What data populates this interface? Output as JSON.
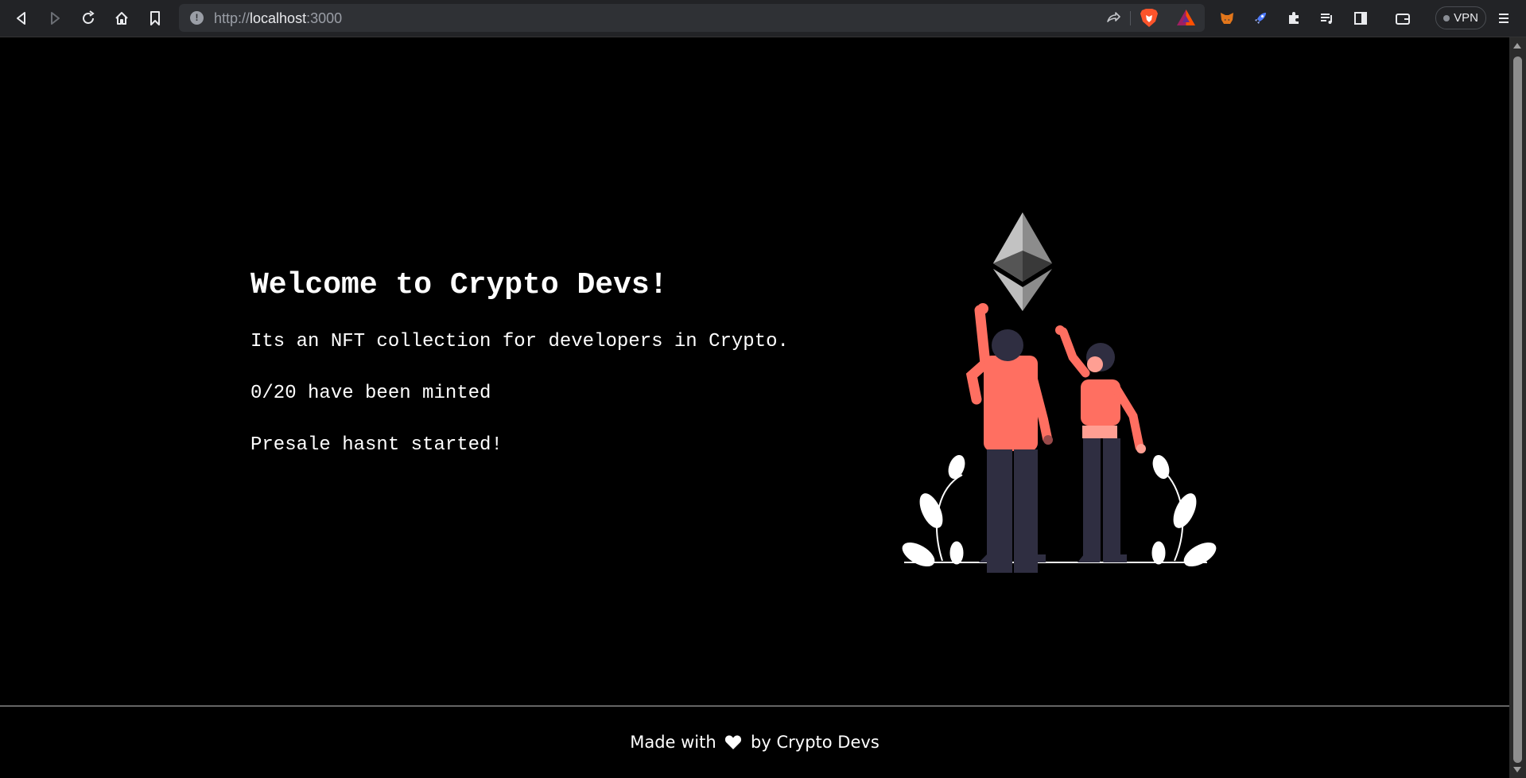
{
  "browser": {
    "url_scheme": "http://",
    "url_host": "localhost",
    "url_port": ":3000",
    "vpn_label": "VPN"
  },
  "main": {
    "title": "Welcome to Crypto Devs!",
    "description": "Its an NFT collection for developers in Crypto.",
    "minted": "0/20 have been minted",
    "presale": "Presale hasnt started!"
  },
  "footer": {
    "prefix": "Made with ",
    "suffix": " by Crypto Devs"
  },
  "colors": {
    "accent": "#ff6f61",
    "background": "#000000"
  }
}
